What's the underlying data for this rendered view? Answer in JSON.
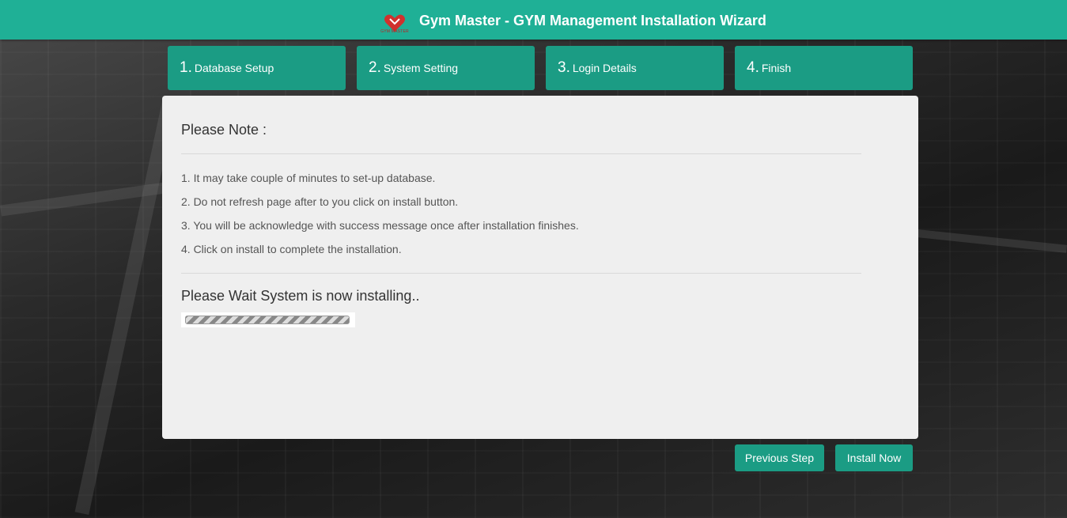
{
  "header": {
    "title": "Gym Master - GYM Management Installation Wizard",
    "logo_text": "GYM MASTER"
  },
  "steps": [
    {
      "num": "1.",
      "label": "Database Setup"
    },
    {
      "num": "2.",
      "label": "System Setting"
    },
    {
      "num": "3.",
      "label": "Login Details"
    },
    {
      "num": "4.",
      "label": "Finish"
    }
  ],
  "panel": {
    "note_title": "Please Note :",
    "notes": [
      "1. It may take couple of minutes to set-up database.",
      "2. Do not refresh page after to you click on install button.",
      "3. You will be acknowledge with success message once after installation finishes.",
      "4. Click on install to complete the installation."
    ],
    "wait_title": "Please Wait System is now installing.."
  },
  "buttons": {
    "previous": "Previous Step",
    "install": "Install Now"
  },
  "colors": {
    "header": "#1fb096",
    "step": "#1b9c84",
    "panel": "#efefef"
  }
}
